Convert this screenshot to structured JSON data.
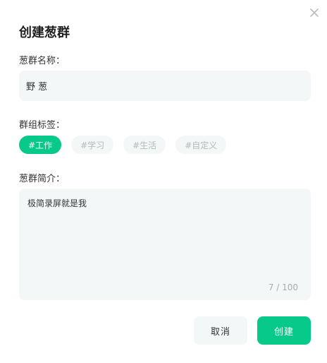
{
  "dialog": {
    "title": "创建葱群",
    "close_icon": "close-icon"
  },
  "name_field": {
    "label": "葱群名称：",
    "value": "野 葱"
  },
  "tags_field": {
    "label": "群组标签：",
    "tags": [
      {
        "label": "#工作",
        "selected": true
      },
      {
        "label": "#学习",
        "selected": false
      },
      {
        "label": "#生活",
        "selected": false
      },
      {
        "label": "#自定义",
        "selected": false
      }
    ]
  },
  "description_field": {
    "label": "葱群简介：",
    "value": "极简录屏就是我",
    "counter": "7 / 100"
  },
  "actions": {
    "cancel_label": "取消",
    "create_label": "创建"
  },
  "colors": {
    "accent": "#07c98a",
    "field_bg": "#f3f7f7",
    "muted_text": "#b4b9bb"
  }
}
